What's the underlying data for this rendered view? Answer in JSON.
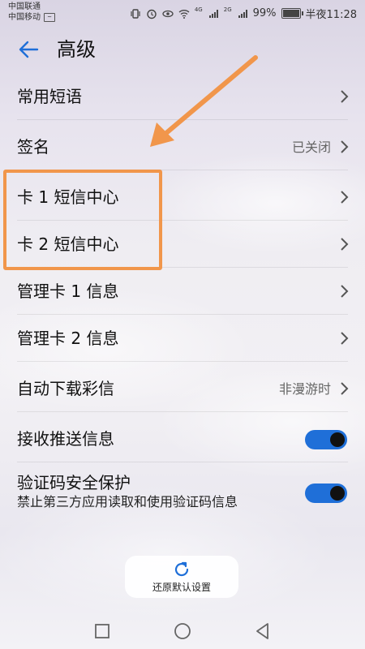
{
  "statusbar": {
    "carrier_1": "中国联通",
    "carrier_2": "中国移动",
    "net_4g": "4G",
    "net_2g": "2G",
    "battery": "99%",
    "time": "半夜11:28"
  },
  "header": {
    "title": "高级"
  },
  "settings": {
    "items": [
      {
        "label": "常用短语"
      },
      {
        "label": "签名",
        "value": "已关闭"
      },
      {
        "label": "卡 1 短信中心"
      },
      {
        "label": "卡 2 短信中心"
      },
      {
        "label": "管理卡 1 信息"
      },
      {
        "label": "管理卡 2 信息"
      },
      {
        "label": "自动下载彩信",
        "value": "非漫游时"
      },
      {
        "label": "接收推送信息",
        "toggle": true
      },
      {
        "label": "验证码安全保护",
        "sublabel": "禁止第三方应用读取和使用验证码信息",
        "toggle": true
      }
    ]
  },
  "restore": {
    "label": "还原默认设置"
  },
  "colors": {
    "accent": "#1f6fd8",
    "highlight": "#f1964b"
  },
  "icons": [
    "back-arrow-icon",
    "chevron-right-icon",
    "refresh-icon",
    "square-nav-icon",
    "circle-nav-icon",
    "triangle-back-nav-icon"
  ]
}
